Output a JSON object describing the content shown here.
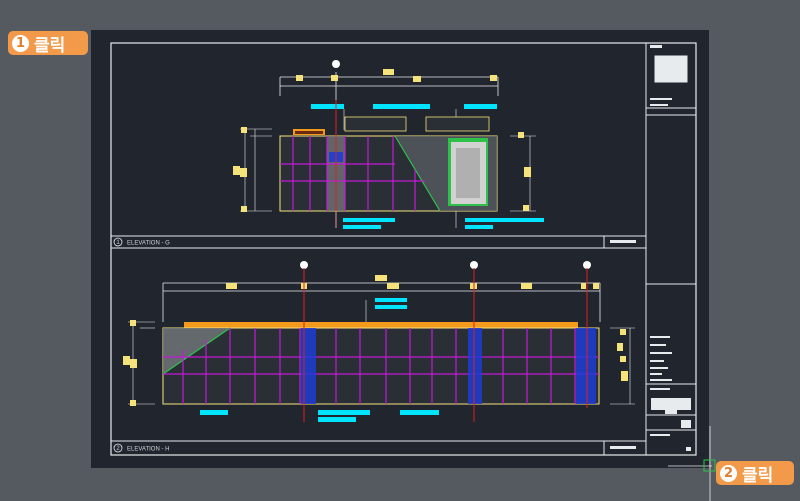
{
  "callouts": {
    "step1": {
      "number": "1",
      "label": "클릭"
    },
    "step2": {
      "number": "2",
      "label": "클릭"
    }
  },
  "drawing": {
    "view_top_title": "ELEVATION - G",
    "view_top_number": "1",
    "view_bottom_title": "ELEVATION - H",
    "view_bottom_number": "2"
  },
  "colors": {
    "background": "#555a61",
    "paper": "#21262e",
    "frame": "#e8ebee",
    "cyan_label": "#00e5ff",
    "yellow_dim": "#f5e27a",
    "magenta_grid": "#c21bd6",
    "green_line": "#2ec24a",
    "red_axis": "#e02020",
    "blue_column": "#1f3cd6",
    "orange_cap": "#f39a1c",
    "callout": "#f29a4a"
  },
  "icons": [
    "crosshair-cursor-icon"
  ]
}
